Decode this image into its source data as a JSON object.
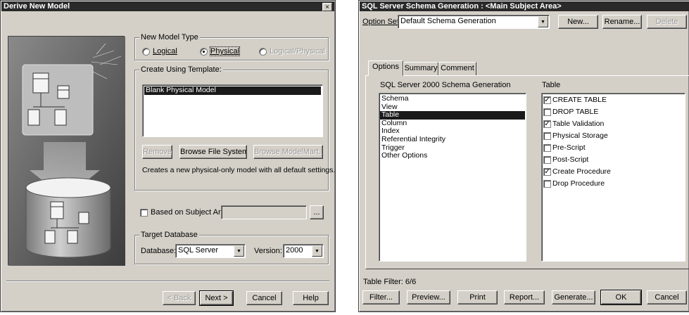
{
  "derive": {
    "title": "Derive New Model",
    "close_glyph": "×",
    "model_type": {
      "legend": "New Model Type",
      "options": [
        {
          "label": "Logical",
          "selected": false,
          "enabled": true
        },
        {
          "label": "Physical",
          "selected": true,
          "enabled": true
        },
        {
          "label": "Logical/Physical",
          "selected": false,
          "enabled": false
        }
      ]
    },
    "template": {
      "legend": "Create Using Template:",
      "items": [
        "Blank Physical Model"
      ],
      "selected_index": 0,
      "remove_label": "Remove",
      "browse_fs_label": "Browse File System...",
      "browse_mm_label": "Browse ModelMart...",
      "description": "Creates a new physical-only model with all default settings."
    },
    "subject_areas": {
      "label": "Based on Subject Areas:",
      "checked": false,
      "value": "",
      "ellipsis": "..."
    },
    "target_db": {
      "legend": "Target Database",
      "database_label": "Database:",
      "database_value": "SQL Server",
      "version_label": "Version:",
      "version_value": "2000"
    },
    "buttons": {
      "back": "< Back",
      "next": "Next >",
      "cancel": "Cancel",
      "help": "Help"
    },
    "illustration_icon": "database-model-illustration"
  },
  "schema": {
    "title": "SQL Server Schema Generation : <Main Subject Area>",
    "option_set_label": "Option Set:",
    "option_set_value": "Default Schema Generation",
    "new_label": "New...",
    "rename_label": "Rename...",
    "delete_label": "Delete",
    "tabs": [
      "Options",
      "Summary",
      "Comment"
    ],
    "active_tab": 0,
    "left_heading": "SQL Server 2000 Schema Generation",
    "categories": [
      "Schema",
      "View",
      "Table",
      "Column",
      "Index",
      "Referential Integrity",
      "Trigger",
      "Other Options"
    ],
    "selected_category": 2,
    "right_heading": "Table",
    "options": [
      {
        "label": "CREATE TABLE",
        "checked": true
      },
      {
        "label": "DROP TABLE",
        "checked": false
      },
      {
        "label": "Table Validation",
        "checked": true
      },
      {
        "label": "Physical Storage",
        "checked": false
      },
      {
        "label": "Pre-Script",
        "checked": false
      },
      {
        "label": "Post-Script",
        "checked": false
      },
      {
        "label": "Create Procedure",
        "checked": true
      },
      {
        "label": "Drop Procedure",
        "checked": false
      }
    ],
    "table_filter": "Table Filter: 6/6",
    "buttons": {
      "filter": "Filter...",
      "preview": "Preview...",
      "print": "Print",
      "report": "Report...",
      "generate": "Generate...",
      "ok": "OK",
      "cancel": "Cancel"
    }
  }
}
